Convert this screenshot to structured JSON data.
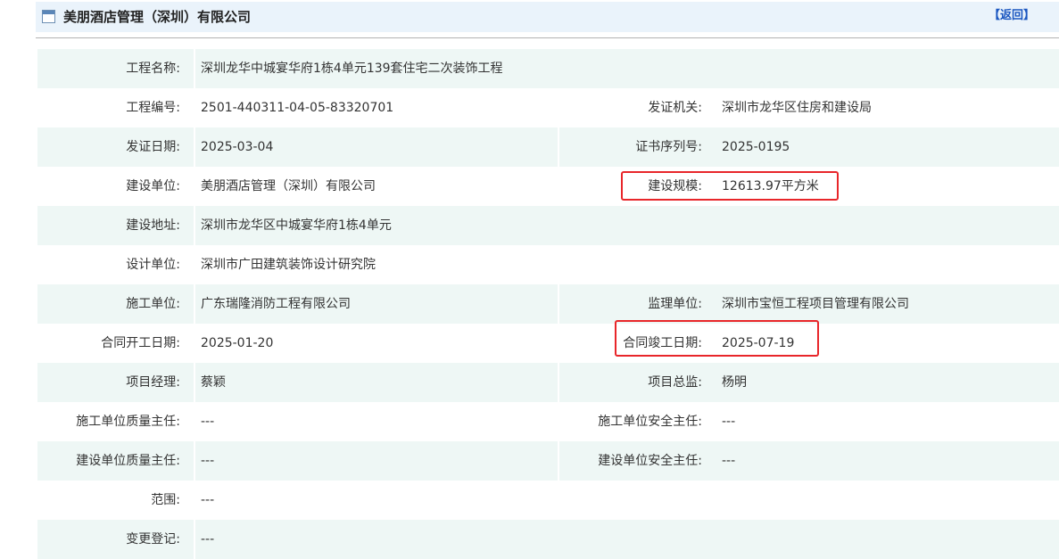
{
  "header": {
    "title": "美朋酒店管理（深圳）有限公司",
    "back_label": "【返回】"
  },
  "rows": [
    {
      "label1": "工程名称:",
      "value1": "深圳龙华中城宴华府1栋4单元139套住宅二次装饰工程",
      "label2": "",
      "value2": ""
    },
    {
      "label1": "工程编号:",
      "value1": "2501-440311-04-05-83320701",
      "label2": "发证机关:",
      "value2": "深圳市龙华区住房和建设局"
    },
    {
      "label1": "发证日期:",
      "value1": "2025-03-04",
      "label2": "证书序列号:",
      "value2": "2025-0195"
    },
    {
      "label1": "建设单位:",
      "value1": "美朋酒店管理（深圳）有限公司",
      "label2": "建设规模:",
      "value2": "12613.97平方米"
    },
    {
      "label1": "建设地址:",
      "value1": "深圳市龙华区中城宴华府1栋4单元",
      "label2": "",
      "value2": ""
    },
    {
      "label1": "设计单位:",
      "value1": "深圳市广田建筑装饰设计研究院",
      "label2": "",
      "value2": ""
    },
    {
      "label1": "施工单位:",
      "value1": "广东瑞隆消防工程有限公司",
      "label2": "监理单位:",
      "value2": "深圳市宝恒工程项目管理有限公司"
    },
    {
      "label1": "合同开工日期:",
      "value1": "2025-01-20",
      "label2": "合同竣工日期:",
      "value2": "2025-07-19"
    },
    {
      "label1": "项目经理:",
      "value1": "蔡颖",
      "label2": "项目总监:",
      "value2": "杨明"
    },
    {
      "label1": "施工单位质量主任:",
      "value1": "---",
      "label2": "施工单位安全主任:",
      "value2": "---"
    },
    {
      "label1": "建设单位质量主任:",
      "value1": "---",
      "label2": "建设单位安全主任:",
      "value2": "---"
    },
    {
      "label1": "范围:",
      "value1": "---",
      "label2": "",
      "value2": ""
    },
    {
      "label1": "变更登记:",
      "value1": "---",
      "label2": "",
      "value2": ""
    }
  ],
  "colors": {
    "row_stripe": "#eef7f5",
    "header_bg": "#eaf3fb",
    "highlight": "#e8262a",
    "link": "#1a56c0"
  }
}
